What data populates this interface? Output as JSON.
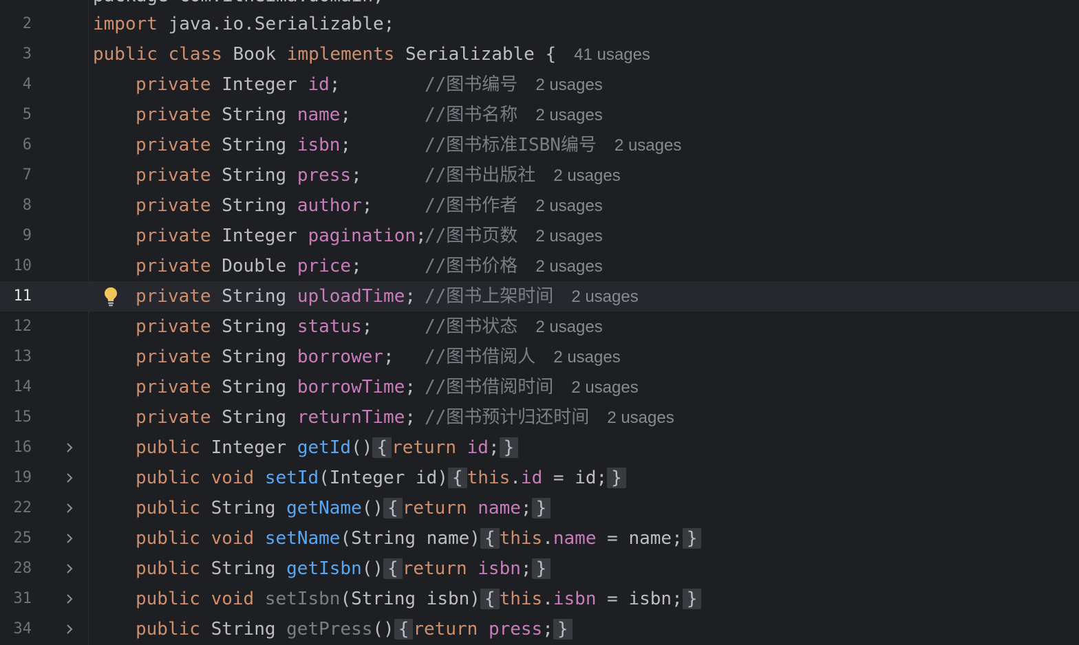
{
  "editor": {
    "partial_line": "package com.itheima.domain;",
    "line2": {
      "num": "2",
      "kw": "import",
      "rest": " java.io.Serializable;"
    },
    "line3": {
      "num": "3",
      "kw1": "public",
      "kw2": "class",
      "name": "Book",
      "kw3": "implements",
      "iface": "Serializable {",
      "usages": "41 usages"
    },
    "fields": [
      {
        "num": "4",
        "kw": "private",
        "type": "Integer",
        "name": "id",
        "pad": ";        ",
        "comment": "//图书编号",
        "usages": "2 usages"
      },
      {
        "num": "5",
        "kw": "private",
        "type": "String",
        "name": "name",
        "pad": ";       ",
        "comment": "//图书名称",
        "usages": "2 usages"
      },
      {
        "num": "6",
        "kw": "private",
        "type": "String",
        "name": "isbn",
        "pad": ";       ",
        "comment": "//图书标准ISBN编号",
        "usages": "2 usages"
      },
      {
        "num": "7",
        "kw": "private",
        "type": "String",
        "name": "press",
        "pad": ";      ",
        "comment": "//图书出版社",
        "usages": "2 usages"
      },
      {
        "num": "8",
        "kw": "private",
        "type": "String",
        "name": "author",
        "pad": ";     ",
        "comment": "//图书作者",
        "usages": "2 usages"
      },
      {
        "num": "9",
        "kw": "private",
        "type": "Integer",
        "name": "pagination",
        "pad": ";",
        "comment": "//图书页数",
        "usages": "2 usages"
      },
      {
        "num": "10",
        "kw": "private",
        "type": "Double",
        "name": "price",
        "pad": ";      ",
        "comment": "//图书价格",
        "usages": "2 usages"
      },
      {
        "num": "11",
        "kw": "private",
        "type": "String",
        "name": "uploadTime",
        "pad": "; ",
        "comment": "//图书上架时间",
        "usages": "2 usages"
      },
      {
        "num": "12",
        "kw": "private",
        "type": "String",
        "name": "status",
        "pad": ";     ",
        "comment": "//图书状态",
        "usages": "2 usages"
      },
      {
        "num": "13",
        "kw": "private",
        "type": "String",
        "name": "borrower",
        "pad": ";   ",
        "comment": "//图书借阅人",
        "usages": "2 usages"
      },
      {
        "num": "14",
        "kw": "private",
        "type": "String",
        "name": "borrowTime",
        "pad": "; ",
        "comment": "//图书借阅时间",
        "usages": "2 usages"
      },
      {
        "num": "15",
        "kw": "private",
        "type": "String",
        "name": "returnTime",
        "pad": "; ",
        "comment": "//图书预计归还时间",
        "usages": "2 usages"
      }
    ],
    "methods": {
      "m16": {
        "num": "16",
        "kw": "public",
        "type": "Integer",
        "fn": "getId",
        "args": "()",
        "ret": "return",
        "val": "id",
        "end": ";"
      },
      "m19": {
        "num": "19",
        "kw": "public",
        "kw2": "void",
        "fn": "setId",
        "args": "(Integer id)",
        "this": "this",
        "dot": ".",
        "fld": "id",
        "rest": " = id;"
      },
      "m22": {
        "num": "22",
        "kw": "public",
        "type": "String",
        "fn": "getName",
        "args": "()",
        "ret": "return",
        "val": "name",
        "end": ";"
      },
      "m25": {
        "num": "25",
        "kw": "public",
        "kw2": "void",
        "fn": "setName",
        "args": "(String name)",
        "this": "this",
        "dot": ".",
        "fld": "name",
        "rest": " = name;"
      },
      "m28": {
        "num": "28",
        "kw": "public",
        "type": "String",
        "fn": "getIsbn",
        "args": "()",
        "ret": "return",
        "val": "isbn",
        "end": ";"
      },
      "m31": {
        "num": "31",
        "kw": "public",
        "kw2": "void",
        "fn": "setIsbn",
        "args": "(String isbn)",
        "this": "this",
        "dot": ".",
        "fld": "isbn",
        "rest": " = isbn;"
      },
      "m34": {
        "num": "34",
        "kw": "public",
        "type": "String",
        "fn": "getPress",
        "args": "()",
        "ret": "return",
        "val": "press",
        "end": ";"
      }
    },
    "brace_open": "{",
    "brace_close": "}",
    "space": " ",
    "current_line": "11",
    "colors": {
      "background": "#1e1f22",
      "keyword": "#cf8e6d",
      "field": "#c77dbb",
      "method": "#56a8f5",
      "comment": "#7a7e85",
      "text": "#bcbec4",
      "line_number": "#6f737a",
      "current_line": "#26282e"
    },
    "icons": {
      "fold": "chevron-right-icon",
      "intention": "lightbulb-icon"
    }
  }
}
